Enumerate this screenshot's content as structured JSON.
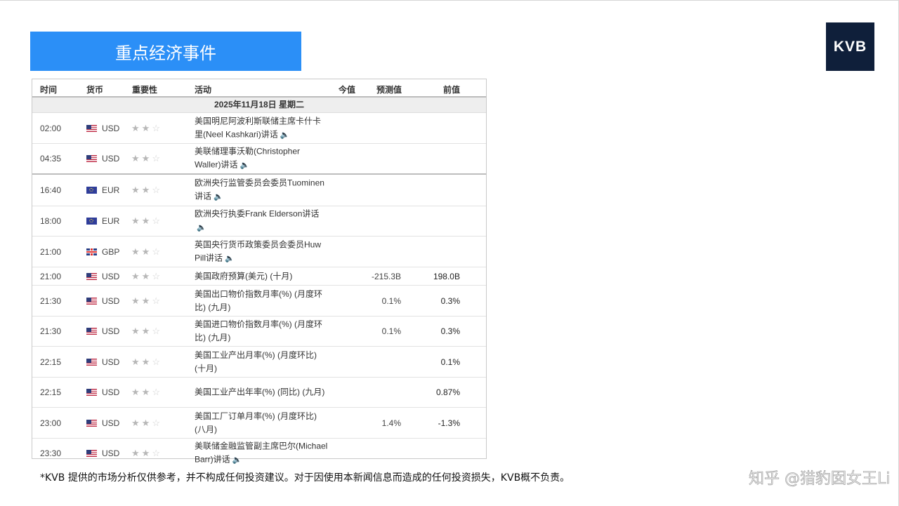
{
  "title": "重点经济事件",
  "logo": "KVB",
  "headers": {
    "time": "时间",
    "currency": "货币",
    "importance": "重要性",
    "event": "活动",
    "actual": "今值",
    "forecast": "预测值",
    "previous": "前值"
  },
  "date": "2025年11月18日  星期二",
  "rows": [
    {
      "time": "02:00",
      "flag": "us",
      "currency": "USD",
      "event": "美国明尼阿波利斯联储主席卡什卡里(Neel Kashkari)讲话",
      "speech": true,
      "actual": "",
      "forecast": "",
      "previous": ""
    },
    {
      "time": "04:35",
      "flag": "us",
      "currency": "USD",
      "event": "美联储理事沃勒(Christopher Waller)讲话",
      "speech": true,
      "actual": "",
      "forecast": "",
      "previous": ""
    },
    {
      "time": "16:40",
      "flag": "eu",
      "currency": "EUR",
      "event": "欧洲央行监管委员会委员Tuominen讲话",
      "speech": true,
      "actual": "",
      "forecast": "",
      "previous": ""
    },
    {
      "time": "18:00",
      "flag": "eu",
      "currency": "EUR",
      "event": "欧洲央行执委Frank Elderson讲话",
      "speech": true,
      "actual": "",
      "forecast": "",
      "previous": ""
    },
    {
      "time": "21:00",
      "flag": "gb",
      "currency": "GBP",
      "event": "英国央行货币政策委员会委员Huw Pill讲话",
      "speech": true,
      "actual": "",
      "forecast": "",
      "previous": ""
    },
    {
      "time": "21:00",
      "flag": "us",
      "currency": "USD",
      "event": "美国政府预算(美元) (十月)",
      "speech": false,
      "actual": "",
      "forecast": "-215.3B",
      "previous": "198.0B"
    },
    {
      "time": "21:30",
      "flag": "us",
      "currency": "USD",
      "event": "美国出口物价指数月率(%) (月度环比) (九月)",
      "speech": false,
      "actual": "",
      "forecast": "0.1%",
      "previous": "0.3%"
    },
    {
      "time": "21:30",
      "flag": "us",
      "currency": "USD",
      "event": "美国进口物价指数月率(%) (月度环比) (九月)",
      "speech": false,
      "actual": "",
      "forecast": "0.1%",
      "previous": "0.3%"
    },
    {
      "time": "22:15",
      "flag": "us",
      "currency": "USD",
      "event": "美国工业产出月率(%) (月度环比) (十月)",
      "speech": false,
      "actual": "",
      "forecast": "",
      "previous": "0.1%"
    },
    {
      "time": "22:15",
      "flag": "us",
      "currency": "USD",
      "event": "美国工业产出年率(%) (同比) (九月)",
      "speech": false,
      "actual": "",
      "forecast": "",
      "previous": "0.87%"
    },
    {
      "time": "23:00",
      "flag": "us",
      "currency": "USD",
      "event": "美国工厂订单月率(%) (月度环比) (八月)",
      "speech": false,
      "actual": "",
      "forecast": "1.4%",
      "previous": "-1.3%"
    },
    {
      "time": "23:30",
      "flag": "us",
      "currency": "USD",
      "event": "美联储金融监管副主席巴尔(Michael Barr)讲话",
      "speech": true,
      "actual": "",
      "forecast": "",
      "previous": ""
    }
  ],
  "importance_stars": {
    "filled": "★★",
    "empty": "☆"
  },
  "speech_icon": "speaker-icon",
  "disclaimer": "*KVB 提供的市场分析仅供参考，并不构成任何投资建议。对于因使用本新闻信息而造成的任何投资损失，KVB概不负责。",
  "watermark": "知乎 @猎豹囡女王Li"
}
